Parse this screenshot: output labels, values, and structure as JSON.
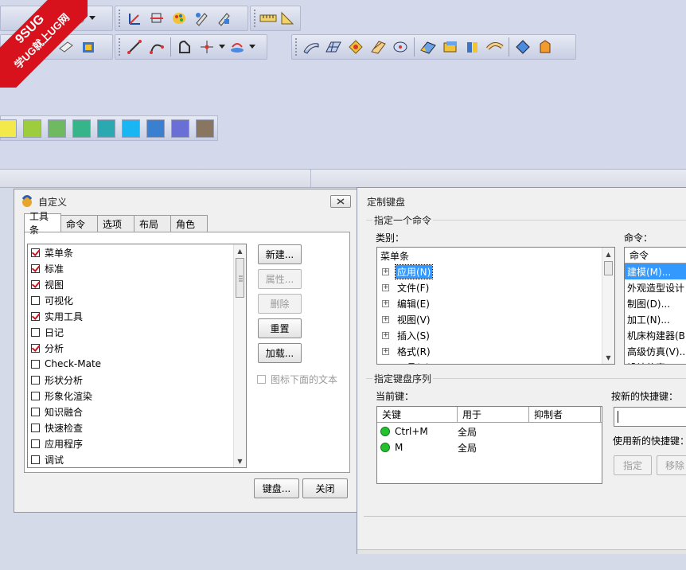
{
  "watermark": {
    "line1": "9SUG",
    "line2": "学UG就上UG网"
  },
  "palette": {
    "colors": [
      "#f4e94a",
      "#9dcc3c",
      "#6fba60",
      "#36b48a",
      "#2ba9b0",
      "#19b6f3",
      "#3b7fd0",
      "#6a6fd6",
      "#8a7561"
    ]
  },
  "customize_dialog": {
    "title": "自定义",
    "tabs": [
      "工具条",
      "命令",
      "选项",
      "布局",
      "角色"
    ],
    "toolbar_items": [
      {
        "label": "菜单条",
        "checked": true
      },
      {
        "label": "标准",
        "checked": true
      },
      {
        "label": "视图",
        "checked": true
      },
      {
        "label": "可视化",
        "checked": false
      },
      {
        "label": "实用工具",
        "checked": true
      },
      {
        "label": "日记",
        "checked": false
      },
      {
        "label": "分析",
        "checked": true
      },
      {
        "label": "Check-Mate",
        "checked": false
      },
      {
        "label": "形状分析",
        "checked": false
      },
      {
        "label": "形象化渲染",
        "checked": false
      },
      {
        "label": "知识融合",
        "checked": false
      },
      {
        "label": "快速检查",
        "checked": false
      },
      {
        "label": "应用程序",
        "checked": false
      },
      {
        "label": "调试",
        "checked": false
      }
    ],
    "buttons": {
      "new": "新建...",
      "properties": "属性...",
      "delete": "删除",
      "reset": "重置",
      "load": "加载..."
    },
    "text_below_icon": {
      "label": "图标下面的文本",
      "checked": false
    },
    "keyboard_button": "键盘...",
    "close_button": "关闭"
  },
  "keyboard_dialog": {
    "title": "定制键盘",
    "specify_command_group": "指定一个命令",
    "category_label": "类别：",
    "category_tree": {
      "root": "菜单条",
      "items": [
        {
          "label": "应用(N)",
          "selected": true
        },
        {
          "label": "文件(F)",
          "selected": false
        },
        {
          "label": "编辑(E)",
          "selected": false
        },
        {
          "label": "视图(V)",
          "selected": false
        },
        {
          "label": "插入(S)",
          "selected": false
        },
        {
          "label": "格式(R)",
          "selected": false
        },
        {
          "label": "工具(T)",
          "selected": false
        }
      ]
    },
    "command_label": "命令：",
    "command_header": "命令",
    "commands": [
      {
        "label": "建模(M)...",
        "selected": true
      },
      {
        "label": "外观造型设计",
        "selected": false
      },
      {
        "label": "制图(D)...",
        "selected": false
      },
      {
        "label": "加工(N)...",
        "selected": false
      },
      {
        "label": "机床构建器(B)",
        "selected": false
      },
      {
        "label": "高级仿真(V)...",
        "selected": false
      },
      {
        "label": "设计仿真",
        "selected": false
      }
    ],
    "sequence_group": "指定键盘序列",
    "current_keys_label": "当前键：",
    "columns": [
      "关键",
      "用于",
      "抑制者"
    ],
    "current_keys": [
      {
        "key": "Ctrl+M",
        "scope": "全局",
        "suppressor": ""
      },
      {
        "key": "M",
        "scope": "全局",
        "suppressor": ""
      }
    ],
    "new_shortcut_label": "按新的快捷键：",
    "new_shortcut_value": "",
    "use_new_shortcut_label": "使用新的快捷键：",
    "assign_button": "指定",
    "remove_button": "移除"
  }
}
